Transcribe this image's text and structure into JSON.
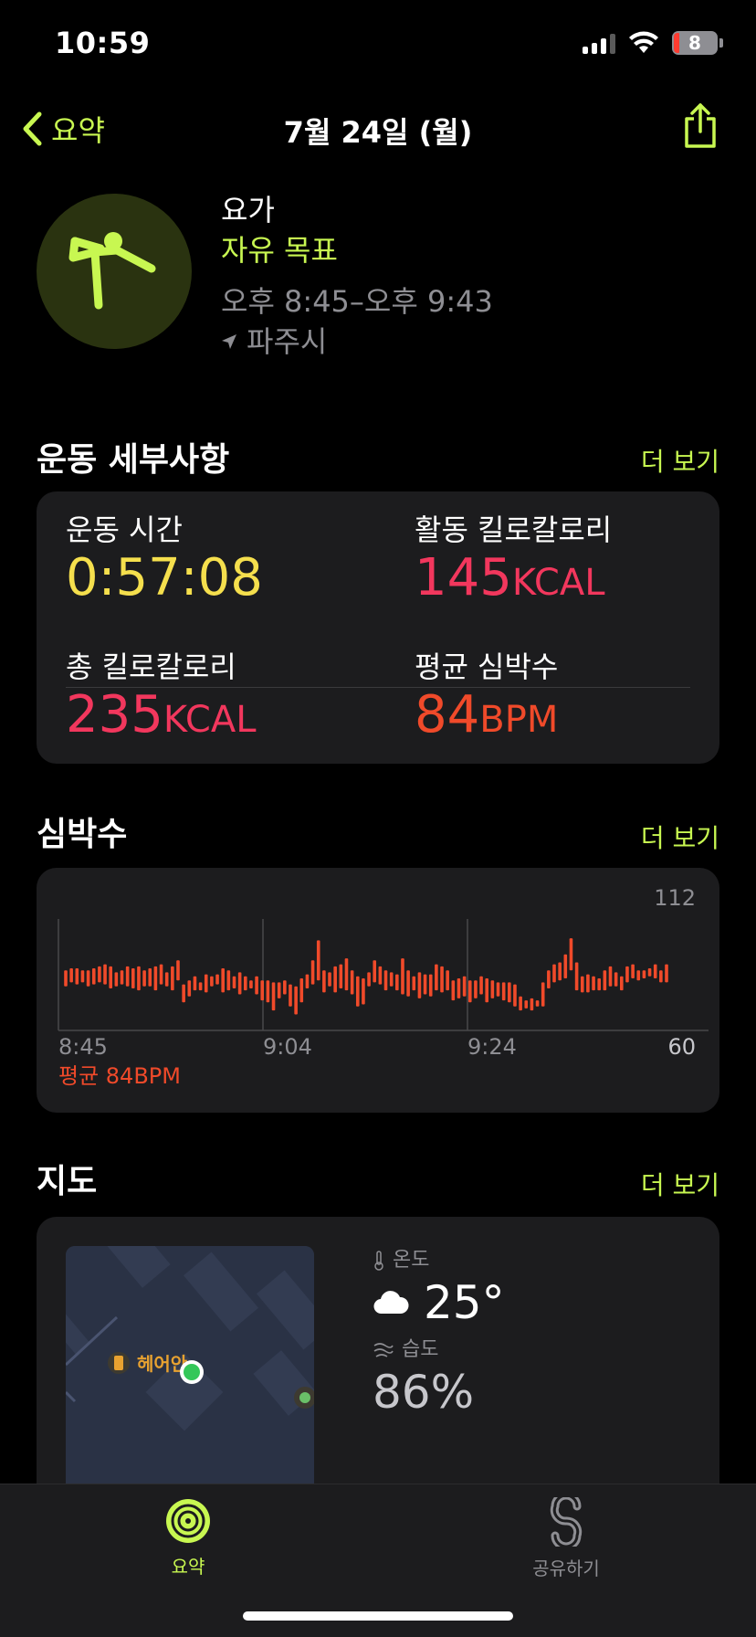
{
  "status": {
    "time": "10:59",
    "battery": "8"
  },
  "nav": {
    "back_label": "요약",
    "title": "7월 24일 (월)"
  },
  "workout": {
    "name": "요가",
    "goal": "자유 목표",
    "time_range": "오후 8:45–오후 9:43",
    "location": "파주시"
  },
  "details": {
    "section_title": "운동 세부사항",
    "more": "더 보기",
    "duration": {
      "label": "운동 시간",
      "value": "0:57:08"
    },
    "active_kcal": {
      "label": "활동 킬로칼로리",
      "value": "145",
      "unit": "KCAL"
    },
    "total_kcal": {
      "label": "총 킬로칼로리",
      "value": "235",
      "unit": "KCAL"
    },
    "avg_hr": {
      "label": "평균 심박수",
      "value": "84",
      "unit": "BPM"
    }
  },
  "heart": {
    "section_title": "심박수",
    "more": "더 보기",
    "avg_label": "평균 84BPM"
  },
  "chart_data": {
    "type": "bar",
    "title": "",
    "x_ticks": [
      "8:45",
      "9:04",
      "9:24"
    ],
    "y_max_label": "112",
    "y_min_label": "60",
    "ylim": [
      60,
      112
    ],
    "color": "#f04a2a",
    "bars": [
      [
        82,
        90
      ],
      [
        84,
        91
      ],
      [
        83,
        91
      ],
      [
        84,
        90
      ],
      [
        82,
        90
      ],
      [
        83,
        91
      ],
      [
        84,
        92
      ],
      [
        83,
        93
      ],
      [
        81,
        92
      ],
      [
        82,
        89
      ],
      [
        83,
        90
      ],
      [
        82,
        92
      ],
      [
        81,
        91
      ],
      [
        80,
        92
      ],
      [
        82,
        90
      ],
      [
        82,
        91
      ],
      [
        80,
        92
      ],
      [
        83,
        93
      ],
      [
        82,
        89
      ],
      [
        80,
        92
      ],
      [
        85,
        95
      ],
      [
        74,
        83
      ],
      [
        77,
        85
      ],
      [
        80,
        87
      ],
      [
        80,
        84
      ],
      [
        79,
        88
      ],
      [
        82,
        87
      ],
      [
        83,
        88
      ],
      [
        79,
        91
      ],
      [
        80,
        90
      ],
      [
        81,
        87
      ],
      [
        78,
        89
      ],
      [
        80,
        87
      ],
      [
        81,
        85
      ],
      [
        78,
        87
      ],
      [
        75,
        85
      ],
      [
        74,
        85
      ],
      [
        70,
        84
      ],
      [
        76,
        84
      ],
      [
        78,
        85
      ],
      [
        72,
        83
      ],
      [
        68,
        82
      ],
      [
        74,
        86
      ],
      [
        81,
        88
      ],
      [
        83,
        95
      ],
      [
        85,
        105
      ],
      [
        79,
        90
      ],
      [
        82,
        89
      ],
      [
        79,
        92
      ],
      [
        81,
        93
      ],
      [
        80,
        96
      ],
      [
        78,
        90
      ],
      [
        72,
        87
      ],
      [
        73,
        86
      ],
      [
        82,
        89
      ],
      [
        84,
        95
      ],
      [
        83,
        92
      ],
      [
        80,
        90
      ],
      [
        82,
        89
      ],
      [
        80,
        88
      ],
      [
        78,
        96
      ],
      [
        77,
        90
      ],
      [
        80,
        87
      ],
      [
        76,
        89
      ],
      [
        78,
        88
      ],
      [
        77,
        88
      ],
      [
        80,
        93
      ],
      [
        79,
        92
      ],
      [
        80,
        90
      ],
      [
        75,
        85
      ],
      [
        76,
        86
      ],
      [
        77,
        87
      ],
      [
        74,
        85
      ],
      [
        76,
        85
      ],
      [
        78,
        87
      ],
      [
        74,
        86
      ],
      [
        76,
        85
      ],
      [
        77,
        84
      ],
      [
        75,
        84
      ],
      [
        74,
        84
      ],
      [
        72,
        83
      ],
      [
        70,
        77
      ],
      [
        71,
        75
      ],
      [
        70,
        76
      ],
      [
        72,
        75
      ],
      [
        72,
        84
      ],
      [
        81,
        90
      ],
      [
        84,
        93
      ],
      [
        85,
        94
      ],
      [
        86,
        98
      ],
      [
        90,
        106
      ],
      [
        80,
        94
      ],
      [
        79,
        87
      ],
      [
        79,
        88
      ],
      [
        80,
        87
      ],
      [
        80,
        86
      ],
      [
        80,
        90
      ],
      [
        82,
        92
      ],
      [
        82,
        89
      ],
      [
        80,
        87
      ],
      [
        84,
        92
      ],
      [
        86,
        93
      ],
      [
        85,
        90
      ],
      [
        86,
        90
      ],
      [
        87,
        91
      ],
      [
        86,
        93
      ],
      [
        84,
        90
      ],
      [
        84,
        93
      ]
    ]
  },
  "map": {
    "section_title": "지도",
    "more": "더 보기",
    "place_label": "헤어안",
    "temp_label": "온도",
    "temp_value": "25°",
    "humidity_label": "습도",
    "humidity_value": "86%"
  },
  "tabs": [
    {
      "label": "요약",
      "color": "#c8f751"
    },
    {
      "label": "공유하기",
      "color": "#8e8e93"
    }
  ]
}
